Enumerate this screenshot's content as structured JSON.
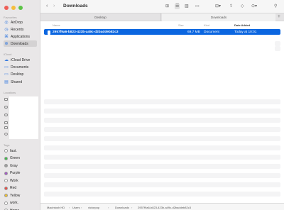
{
  "window": {
    "title": "Downloads"
  },
  "sidebar": {
    "favourites_header": "Favourites",
    "favourites": [
      "AirDrop",
      "Recents",
      "Applications",
      "Downloads"
    ],
    "icloud_header": "iCloud",
    "icloud": [
      "iCloud Drive",
      "Documents",
      "Desktop",
      "Shared"
    ],
    "locations_header": "Locations",
    "tags_header": "Tags",
    "tags": [
      {
        "label": "faut.",
        "color": "#ffffff"
      },
      {
        "label": "Green",
        "color": "#3fbf4a"
      },
      {
        "label": "Gray",
        "color": "#9e9e9e"
      },
      {
        "label": "Purple",
        "color": "#a45ac7"
      },
      {
        "label": "Work",
        "color": "#ffffff"
      },
      {
        "label": "Red",
        "color": "#ee4b43"
      },
      {
        "label": "Yellow",
        "color": "#f2c230"
      },
      {
        "label": "work.",
        "color": "#ffffff"
      },
      {
        "label": "Home",
        "color": "#ffffff"
      }
    ]
  },
  "tabs": [
    "Desktop",
    "Downloads"
  ],
  "columns": {
    "name": "Name",
    "size": "Size",
    "kind": "Kind",
    "date": "Date Added"
  },
  "file": {
    "name": "2957f9a6-b823-423b-a49c-d2baddeb82c3",
    "size": "69,7 MB",
    "kind": "Document",
    "date": "Today at 10:01"
  },
  "path": [
    "Macintosh HD",
    "Users",
    "victorpop",
    "Downloads",
    "2957f9a6-b823-423b-a49c-d2baddeb82c3"
  ]
}
